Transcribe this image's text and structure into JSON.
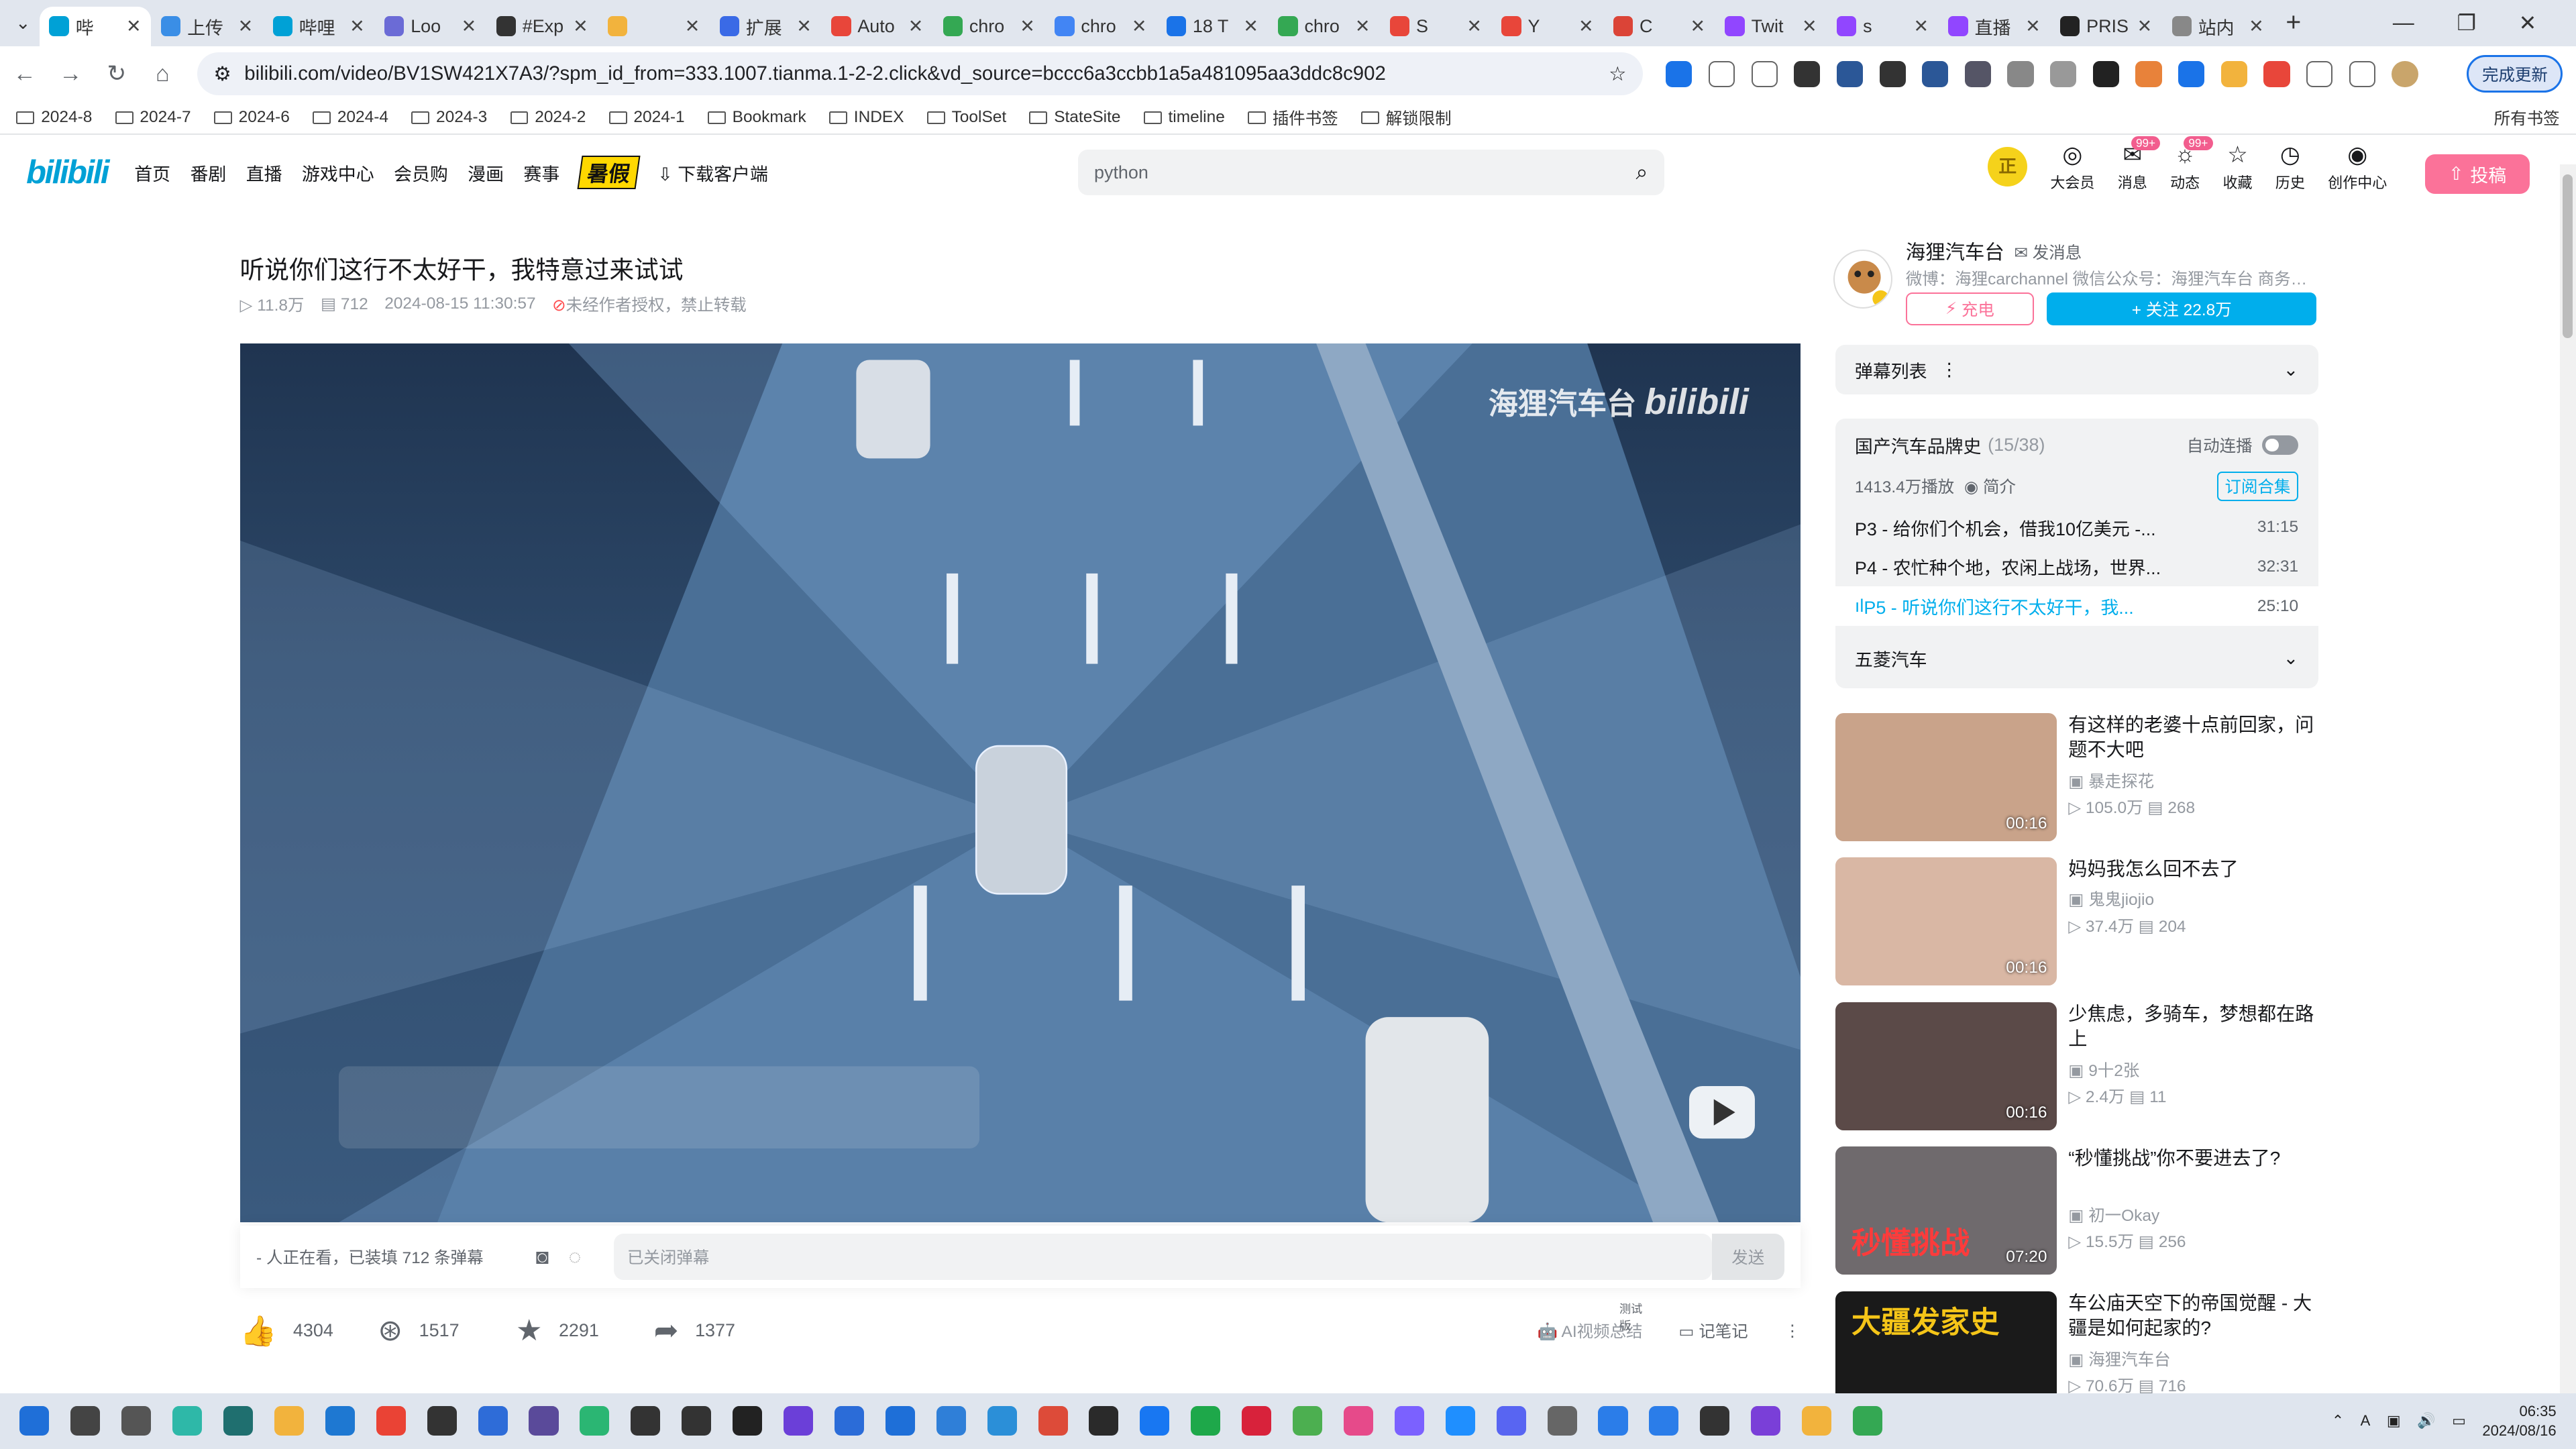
{
  "browser": {
    "tabs": [
      {
        "title": "哔",
        "color": "#00a1d6",
        "active": true
      },
      {
        "title": "上传",
        "color": "#3a8ee6"
      },
      {
        "title": "哔哩",
        "color": "#00a1d6"
      },
      {
        "title": "Loo",
        "color": "#6b6bd6"
      },
      {
        "title": "#Exp",
        "color": "#333"
      },
      {
        "title": "",
        "color": "#f2b33d"
      },
      {
        "title": "扩展",
        "color": "#3a6ae6"
      },
      {
        "title": "Auto",
        "color": "#e8463a"
      },
      {
        "title": "chro",
        "color": "#34a853"
      },
      {
        "title": "chro",
        "color": "#4285f4"
      },
      {
        "title": "18 T",
        "color": "#1a73e8"
      },
      {
        "title": "chro",
        "color": "#34a853"
      },
      {
        "title": "S",
        "color": "#e8463a"
      },
      {
        "title": "Y",
        "color": "#e8463a"
      },
      {
        "title": "C",
        "color": "#db4437"
      },
      {
        "title": "Twit",
        "color": "#9146ff"
      },
      {
        "title": "s",
        "color": "#9146ff"
      },
      {
        "title": "直播",
        "color": "#9146ff"
      },
      {
        "title": "PRIS",
        "color": "#222"
      },
      {
        "title": "站内",
        "color": "#888"
      }
    ],
    "url": "bilibili.com/video/BV1SW421X7A3/?spm_id_from=333.1007.tianma.1-2-2.click&vd_source=bccc6a3ccbb1a5a481095aa3ddc8c902",
    "update_label": "完成更新",
    "bookmarks": [
      "2024-8",
      "2024-7",
      "2024-6",
      "2024-4",
      "2024-3",
      "2024-2",
      "2024-1",
      "Bookmark",
      "INDEX",
      "ToolSet",
      "StateSite",
      "timeline",
      "插件书签",
      "解锁限制"
    ],
    "bookmarks_all": "所有书签"
  },
  "site": {
    "logo": "bilibili",
    "nav": [
      "首页",
      "番剧",
      "直播",
      "游戏中心",
      "会员购",
      "漫画",
      "赛事"
    ],
    "summer": "暑假",
    "download": "下载客户端",
    "search_placeholder": "python",
    "right_icons": [
      {
        "label": "大会员",
        "glyph": "◎"
      },
      {
        "label": "消息",
        "glyph": "✉",
        "badge": "99+"
      },
      {
        "label": "动态",
        "glyph": "☼",
        "badge": "99+"
      },
      {
        "label": "收藏",
        "glyph": "☆"
      },
      {
        "label": "历史",
        "glyph": "◷"
      },
      {
        "label": "创作中心",
        "glyph": "◉"
      }
    ],
    "avatar_text": "正",
    "upload": "投稿"
  },
  "video": {
    "title": "听说你们这行不太好干，我特意过来试试",
    "views": "11.8万",
    "danmaku": "712",
    "date": "2024-08-15 11:30:57",
    "copyright": "未经作者授权，禁止转载",
    "watermark": "海狸汽车台",
    "watermark2": "bilibili",
    "danmaku_status": "- 人正在看，已装填 712 条弹幕",
    "danmaku_placeholder": "已关闭弹幕",
    "send": "发送",
    "likes": "4304",
    "coins": "1517",
    "favs": "2291",
    "shares": "1377",
    "ai_summary": "AI视频总结",
    "ai_tag": "测试版",
    "notes": "记笔记"
  },
  "uploader": {
    "name": "海狸汽车台",
    "msg": "发消息",
    "desc": "微博：海狸carchannel 微信公众号：海狸汽车台 商务…",
    "charge": "充电",
    "follow": "+ 关注 22.8万"
  },
  "danmaku_list": {
    "label": "弹幕列表"
  },
  "collection": {
    "title": "国产汽车品牌史",
    "count": "(15/38)",
    "autoplay": "自动连播",
    "plays": "1413.4万播放",
    "intro": "简介",
    "subscribe": "订阅合集",
    "episodes": [
      {
        "title": "P3 - 给你们个机会，借我10亿美元 -...",
        "dur": "31:15"
      },
      {
        "title": "P4 - 农忙种个地，农闲上战场，世界...",
        "dur": "32:31"
      },
      {
        "title": "P5 - 听说你们这行不太好干，我...",
        "dur": "25:10",
        "current": true
      }
    ],
    "brand": "五菱汽车"
  },
  "recommend": [
    {
      "title": "有这样的老婆十点前回家，问题不大吧",
      "author": "暴走探花",
      "views": "105.0万",
      "dm": "268",
      "dur": "00:16",
      "color": "#c9a38a"
    },
    {
      "title": "妈妈我怎么回不去了",
      "author": "鬼鬼jiojio",
      "views": "37.4万",
      "dm": "204",
      "dur": "00:16",
      "color": "#d9b7a4"
    },
    {
      "title": "少焦虑，多骑车，梦想都在路上",
      "author": "9十2张",
      "views": "2.4万",
      "dm": "11",
      "dur": "00:16",
      "color": "#5b4a48"
    },
    {
      "title": "“秒懂挑战”你不要进去了?",
      "author": "初一Okay",
      "views": "15.5万",
      "dm": "256",
      "dur": "07:20",
      "color": "#6f6a6d",
      "overlay": "秒懂挑战"
    },
    {
      "title": "车公庙天空下的帝国觉醒 - 大疆是如何起家的?",
      "author": "海狸汽车台",
      "views": "70.6万",
      "dm": "716",
      "dur": "",
      "color": "#1a1a1a",
      "overlay": "大疆发家史"
    }
  ],
  "taskbar": {
    "time": "06:35",
    "date": "2024/08/16",
    "icons": [
      "#1f6fd8",
      "#444",
      "#555",
      "#2eb8a8",
      "#1f6f6f",
      "#f2b33d",
      "#1e78d2",
      "#ea4335",
      "#333",
      "#2e6cd8",
      "#5a4a9a",
      "#2bb673",
      "#333",
      "#333",
      "#222",
      "#6b3fd8",
      "#2b6cd8",
      "#1e6fd8",
      "#2f7fd8",
      "#2b8fd8",
      "#dd4b39",
      "#2a2a2a",
      "#1877f2",
      "#1ea84a",
      "#d8223b",
      "#4caf50",
      "#e64a8a",
      "#7b61ff",
      "#1f8fff",
      "#5865f2",
      "#666",
      "#2b7de9",
      "#2b7de9",
      "#333",
      "#7a3fd8",
      "#f2b33d",
      "#34a853"
    ]
  }
}
